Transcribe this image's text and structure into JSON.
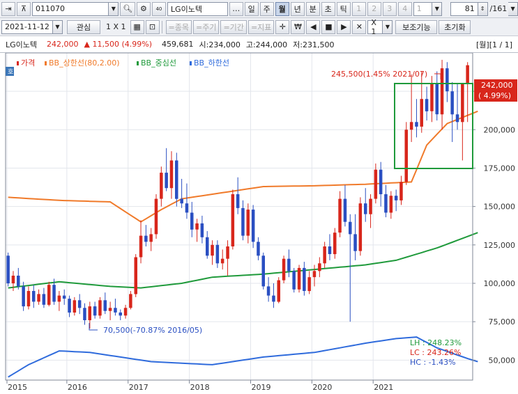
{
  "toolbar1": {
    "code": "011070",
    "name": "LG이노텍",
    "periods": [
      "일",
      "주",
      "월",
      "년",
      "분",
      "초",
      "틱"
    ],
    "active_period": "월",
    "nums": [
      "1",
      "2",
      "3",
      "4"
    ],
    "count": "81",
    "total": "/161"
  },
  "toolbar2": {
    "date": "2021-11-12",
    "interest": "관심",
    "grid": "1 X 1",
    "buttons": [
      "=종목",
      "=주기",
      "=기간",
      "=지표"
    ],
    "x1": "X 1",
    "aux": "보조기능",
    "reset": "초기화"
  },
  "info": {
    "name": "LG이노텍",
    "price": "242,000",
    "change": "▲ 11,500 (4.99%)",
    "volume": "459,681",
    "open": "시:234,000",
    "high": "고:244,000",
    "low": "저:231,500",
    "page": "[월][1 / 1]"
  },
  "legend": {
    "badge": "호",
    "items": [
      "가격",
      "BB_상한선(80,2.00)",
      "BB_중심선",
      "BB_하한선"
    ]
  },
  "annotations": {
    "high": "245,500(1.45% 2021/07)",
    "low": "70,500(-70.87% 2016/05)",
    "price_tag": "242,000",
    "price_pct": "( 4.99%)"
  },
  "stats": {
    "LH": "LH : 248.23%",
    "LC": "LC : 243.26%",
    "HC": "HC : -1.43%"
  },
  "colors": {
    "up": "#d8261b",
    "down": "#2a4fc2",
    "upper_band": "#f07a2a",
    "mid_band": "#1f9a3b",
    "lower_band": "#2f6bdc",
    "highlight_box": "#1f9a3b"
  },
  "chart_data": {
    "type": "candlestick",
    "interval": "monthly",
    "yticks": [
      50000,
      75000,
      100000,
      125000,
      150000,
      175000,
      200000,
      225000
    ],
    "ylim": [
      37000,
      250000
    ],
    "xlabels": [
      "2015",
      "2016",
      "2017",
      "2018",
      "2019",
      "2020",
      "2021"
    ],
    "candles": [
      [
        118000,
        120000,
        98000,
        100000
      ],
      [
        100000,
        108000,
        95000,
        105000
      ],
      [
        105000,
        110000,
        96000,
        98000
      ],
      [
        98000,
        101000,
        82000,
        85000
      ],
      [
        85000,
        98000,
        83000,
        95000
      ],
      [
        95000,
        99000,
        84000,
        88000
      ],
      [
        88000,
        96000,
        86000,
        93000
      ],
      [
        93000,
        97000,
        84000,
        86000
      ],
      [
        86000,
        101000,
        85000,
        99000
      ],
      [
        99000,
        103000,
        86000,
        88000
      ],
      [
        88000,
        95000,
        82000,
        92000
      ],
      [
        92000,
        96000,
        86000,
        90000
      ],
      [
        90000,
        92000,
        78000,
        81000
      ],
      [
        81000,
        91000,
        79000,
        89000
      ],
      [
        89000,
        93000,
        80000,
        84000
      ],
      [
        84000,
        87000,
        73000,
        76000
      ],
      [
        76000,
        88000,
        70500,
        85000
      ],
      [
        85000,
        88000,
        77000,
        79000
      ],
      [
        79000,
        91000,
        77000,
        89000
      ],
      [
        89000,
        94000,
        80000,
        82000
      ],
      [
        82000,
        88000,
        76000,
        84000
      ],
      [
        84000,
        90000,
        79000,
        81000
      ],
      [
        81000,
        83000,
        76000,
        79000
      ],
      [
        79000,
        86000,
        77000,
        84000
      ],
      [
        84000,
        95000,
        83000,
        93000
      ],
      [
        93000,
        119000,
        91000,
        117000
      ],
      [
        117000,
        141000,
        113000,
        131000
      ],
      [
        131000,
        138000,
        124000,
        127000
      ],
      [
        127000,
        136000,
        121000,
        132000
      ],
      [
        132000,
        158000,
        129000,
        155000
      ],
      [
        155000,
        176000,
        150000,
        172000
      ],
      [
        172000,
        188000,
        160000,
        162000
      ],
      [
        162000,
        186000,
        155000,
        180000
      ],
      [
        180000,
        185000,
        150000,
        155000
      ],
      [
        155000,
        168000,
        149000,
        152000
      ],
      [
        152000,
        165000,
        142000,
        146000
      ],
      [
        146000,
        153000,
        130000,
        135000
      ],
      [
        135000,
        142000,
        127000,
        139000
      ],
      [
        139000,
        144000,
        126000,
        130000
      ],
      [
        130000,
        134000,
        116000,
        118000
      ],
      [
        118000,
        128000,
        112000,
        125000
      ],
      [
        125000,
        128000,
        110000,
        113000
      ],
      [
        113000,
        122000,
        109000,
        116000
      ],
      [
        116000,
        128000,
        105000,
        124000
      ],
      [
        124000,
        161000,
        122000,
        158000
      ],
      [
        158000,
        169000,
        145000,
        149000
      ],
      [
        149000,
        154000,
        128000,
        131000
      ],
      [
        131000,
        152000,
        126000,
        148000
      ],
      [
        148000,
        151000,
        123000,
        127000
      ],
      [
        127000,
        130000,
        115000,
        118000
      ],
      [
        118000,
        120000,
        96000,
        98000
      ],
      [
        98000,
        104000,
        88000,
        92000
      ],
      [
        92000,
        100000,
        84000,
        88000
      ],
      [
        88000,
        104000,
        87000,
        102000
      ],
      [
        102000,
        118000,
        100000,
        116000
      ],
      [
        116000,
        122000,
        104000,
        108000
      ],
      [
        108000,
        110000,
        94000,
        96000
      ],
      [
        96000,
        112000,
        94000,
        110000
      ],
      [
        110000,
        114000,
        92000,
        95000
      ],
      [
        95000,
        108000,
        93000,
        104000
      ],
      [
        104000,
        112000,
        98000,
        108000
      ],
      [
        108000,
        117000,
        104000,
        113000
      ],
      [
        113000,
        127000,
        110000,
        124000
      ],
      [
        124000,
        132000,
        115000,
        119000
      ],
      [
        119000,
        136000,
        116000,
        133000
      ],
      [
        133000,
        160000,
        130000,
        155000
      ],
      [
        155000,
        164000,
        137000,
        140000
      ],
      [
        140000,
        145000,
        75000,
        132000
      ],
      [
        132000,
        145000,
        115000,
        121000
      ],
      [
        121000,
        156000,
        118000,
        152000
      ],
      [
        152000,
        162000,
        140000,
        145000
      ],
      [
        145000,
        158000,
        136000,
        155000
      ],
      [
        155000,
        178000,
        152000,
        174000
      ],
      [
        174000,
        179000,
        150000,
        158000
      ],
      [
        158000,
        164000,
        143000,
        146000
      ],
      [
        146000,
        160000,
        142000,
        157000
      ],
      [
        157000,
        161000,
        147000,
        154000
      ],
      [
        154000,
        170000,
        151000,
        166000
      ],
      [
        166000,
        205000,
        164000,
        200000
      ],
      [
        200000,
        236000,
        192000,
        205000
      ],
      [
        205000,
        220000,
        195000,
        202000
      ],
      [
        202000,
        238000,
        198000,
        220000
      ],
      [
        220000,
        228000,
        206000,
        212000
      ],
      [
        212000,
        235000,
        205000,
        230000
      ],
      [
        230000,
        238000,
        206000,
        210000
      ],
      [
        210000,
        245500,
        200000,
        240000
      ],
      [
        240000,
        244000,
        218000,
        225000
      ],
      [
        225000,
        231000,
        192000,
        210000
      ],
      [
        210000,
        230000,
        200000,
        205000
      ],
      [
        205000,
        220000,
        180000,
        230500
      ],
      [
        230500,
        244000,
        205000,
        242000
      ]
    ],
    "bb_upper": [
      [
        0,
        156000
      ],
      [
        10,
        154000
      ],
      [
        20,
        153000
      ],
      [
        26,
        140000
      ],
      [
        30,
        148000
      ],
      [
        34,
        155000
      ],
      [
        40,
        158000
      ],
      [
        50,
        163000
      ],
      [
        60,
        163500
      ],
      [
        70,
        164500
      ],
      [
        79,
        166000
      ],
      [
        82,
        190000
      ],
      [
        86,
        204000
      ],
      [
        92,
        212000
      ]
    ],
    "bb_middle": [
      [
        0,
        97000
      ],
      [
        10,
        101000
      ],
      [
        20,
        98000
      ],
      [
        26,
        97000
      ],
      [
        34,
        100000
      ],
      [
        40,
        104000
      ],
      [
        50,
        106000
      ],
      [
        60,
        109000
      ],
      [
        70,
        112000
      ],
      [
        76,
        115000
      ],
      [
        84,
        123000
      ],
      [
        92,
        133000
      ]
    ],
    "bb_lower": [
      [
        0,
        39000
      ],
      [
        4,
        47000
      ],
      [
        10,
        56000
      ],
      [
        16,
        55000
      ],
      [
        22,
        52000
      ],
      [
        28,
        49000
      ],
      [
        40,
        47000
      ],
      [
        50,
        52000
      ],
      [
        60,
        55000
      ],
      [
        70,
        61000
      ],
      [
        76,
        64000
      ],
      [
        80,
        65000
      ],
      [
        84,
        58000
      ],
      [
        90,
        51000
      ],
      [
        92,
        49000
      ]
    ]
  }
}
